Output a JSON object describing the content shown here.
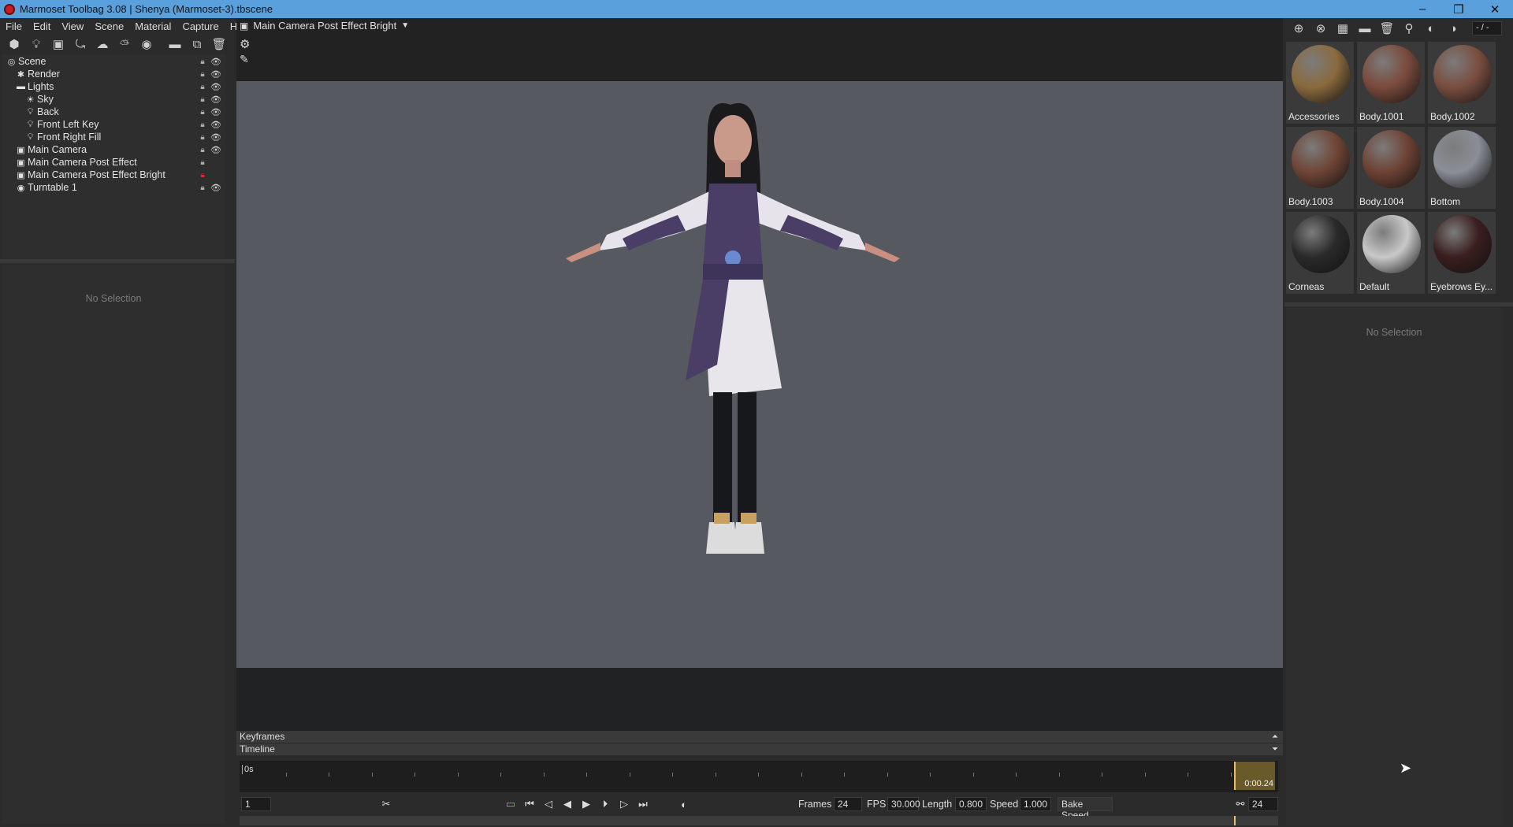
{
  "window": {
    "title": "Marmoset Toolbag 3.08  |  Shenya (Marmoset-3).tbscene",
    "controls": {
      "minimize": "–",
      "restore": "❐",
      "close": "✕"
    }
  },
  "menu": [
    "File",
    "Edit",
    "View",
    "Scene",
    "Material",
    "Capture",
    "Help"
  ],
  "left_toolbar": {
    "icons": [
      "add-object-icon",
      "light-icon",
      "camera-icon",
      "turntable-icon",
      "shadow-catcher-icon",
      "sky-icon",
      "render-icon",
      "folder-icon",
      "duplicate-icon",
      "delete-icon"
    ]
  },
  "scene_tree": [
    {
      "label": "Scene",
      "depth": 0,
      "icon": "scene-icon",
      "lock": true,
      "eye": true
    },
    {
      "label": "Render",
      "depth": 1,
      "icon": "render-icon",
      "lock": true,
      "eye": true
    },
    {
      "label": "Lights",
      "depth": 1,
      "icon": "folder-icon",
      "lock": true,
      "eye": true
    },
    {
      "label": "Sky",
      "depth": 2,
      "icon": "sky-icon",
      "lock": true,
      "eye": true
    },
    {
      "label": "Back",
      "depth": 2,
      "icon": "light-bulb-icon",
      "lock": true,
      "eye": true
    },
    {
      "label": "Front Left Key",
      "depth": 2,
      "icon": "light-bulb-icon",
      "lock": true,
      "eye": true
    },
    {
      "label": "Front Right Fill",
      "depth": 2,
      "icon": "light-bulb-icon",
      "lock": true,
      "eye": true
    },
    {
      "label": "Main Camera",
      "depth": 1,
      "icon": "camera-icon",
      "lock": true,
      "eye": true
    },
    {
      "label": "Main Camera Post Effect",
      "depth": 1,
      "icon": "camera-icon",
      "lock": true,
      "eye": false
    },
    {
      "label": "Main Camera Post Effect Bright",
      "depth": 1,
      "icon": "camera-icon",
      "lock": "red",
      "eye": false
    },
    {
      "label": "Turntable 1",
      "depth": 1,
      "icon": "turntable-icon",
      "lock": true,
      "eye": true
    }
  ],
  "left_props": {
    "empty_text": "No Selection"
  },
  "viewport": {
    "camera_label": "Main Camera Post Effect Bright"
  },
  "timeline": {
    "keyframes_label": "Keyframes",
    "timeline_label": "Timeline",
    "start_label": "0s",
    "cursor_time": "0:00.24",
    "frame_input": "1",
    "frames_label": "Frames",
    "frames_value": "24",
    "fps_label": "FPS",
    "fps_value": "30.000",
    "length_label": "Length",
    "length_value": "0.800",
    "speed_label": "Speed",
    "speed_value": "1.000",
    "bake_label": "Bake Speed",
    "end_frame": "24"
  },
  "materials": {
    "toolbar_icons": [
      "add-material-icon",
      "duplicate-material-icon",
      "checker-icon",
      "open-folder-icon",
      "delete-icon",
      "pick-icon",
      "settings-icon",
      "help-icon"
    ],
    "page_indicator": "- / -",
    "items": [
      {
        "label": "Accessories",
        "color": "#8a6a3e"
      },
      {
        "label": "Body.1001",
        "color": "#7a4a3c"
      },
      {
        "label": "Body.1002",
        "color": "#7a4e40"
      },
      {
        "label": "Body.1003",
        "color": "#6f4536"
      },
      {
        "label": "Body.1004",
        "color": "#6e4234"
      },
      {
        "label": "Bottom",
        "color": "#8a8e96"
      },
      {
        "label": "Corneas",
        "color": "#2a2a2a"
      },
      {
        "label": "Default",
        "color": "#c8c8c8"
      },
      {
        "label": "Eyebrows Ey...",
        "color": "#3a1e1e"
      }
    ],
    "empty_text": "No Selection"
  }
}
